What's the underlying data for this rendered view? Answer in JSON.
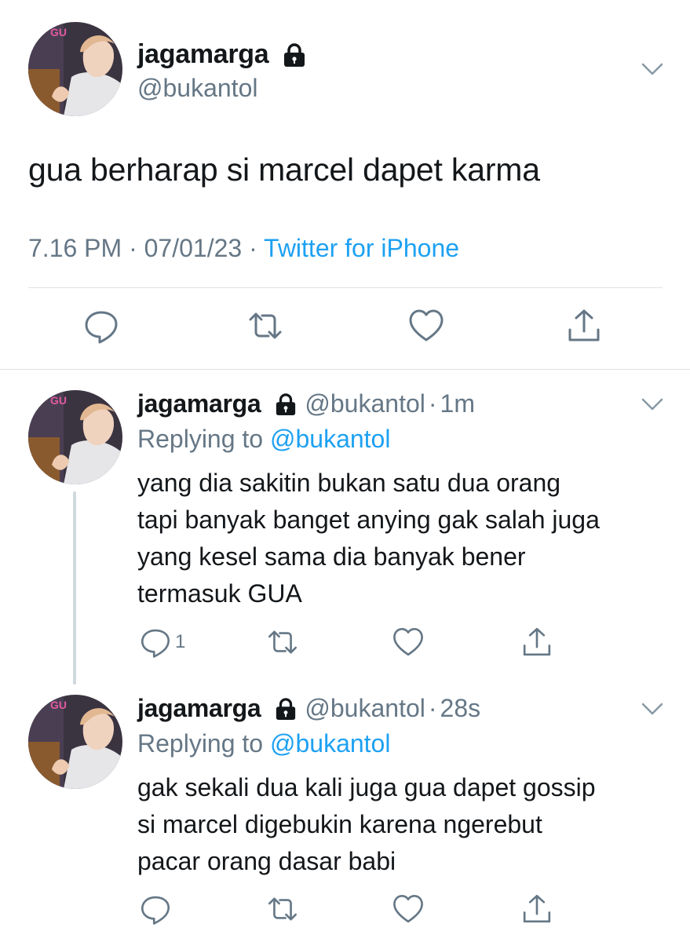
{
  "main_tweet": {
    "display_name": "jagamarga",
    "handle": "@bukantol",
    "text": "gua berharap si marcel dapet karma",
    "time": "7.16 PM",
    "separator": "·",
    "date": "07/01/23",
    "source": "Twitter for iPhone",
    "actions": [
      "reply-icon",
      "retweet-icon",
      "like-icon",
      "share-icon"
    ]
  },
  "replies": [
    {
      "display_name": "jagamarga",
      "handle": "@bukantol",
      "separator": "·",
      "time": "1m",
      "replying_prefix": "Replying to",
      "replying_to": "@bukantol",
      "lines": [
        "yang dia sakitin bukan satu dua orang",
        "tapi banyak banget anying gak salah juga",
        "yang kesel sama dia banyak bener",
        "termasuk GUA"
      ],
      "reply_count": "1"
    },
    {
      "display_name": "jagamarga",
      "handle": "@bukantol",
      "separator": "·",
      "time": "28s",
      "replying_prefix": "Replying to",
      "replying_to": "@bukantol",
      "lines": [
        "gak sekali dua kali juga gua dapet gossip",
        "si marcel digebukin karena ngerebut",
        "pacar orang dasar babi"
      ],
      "reply_count": ""
    }
  ],
  "colors": {
    "text": "#14171a",
    "secondary": "#657786",
    "accent": "#1da1f2",
    "divider": "#dfe3e6",
    "thread_line": "#cfd9de"
  }
}
